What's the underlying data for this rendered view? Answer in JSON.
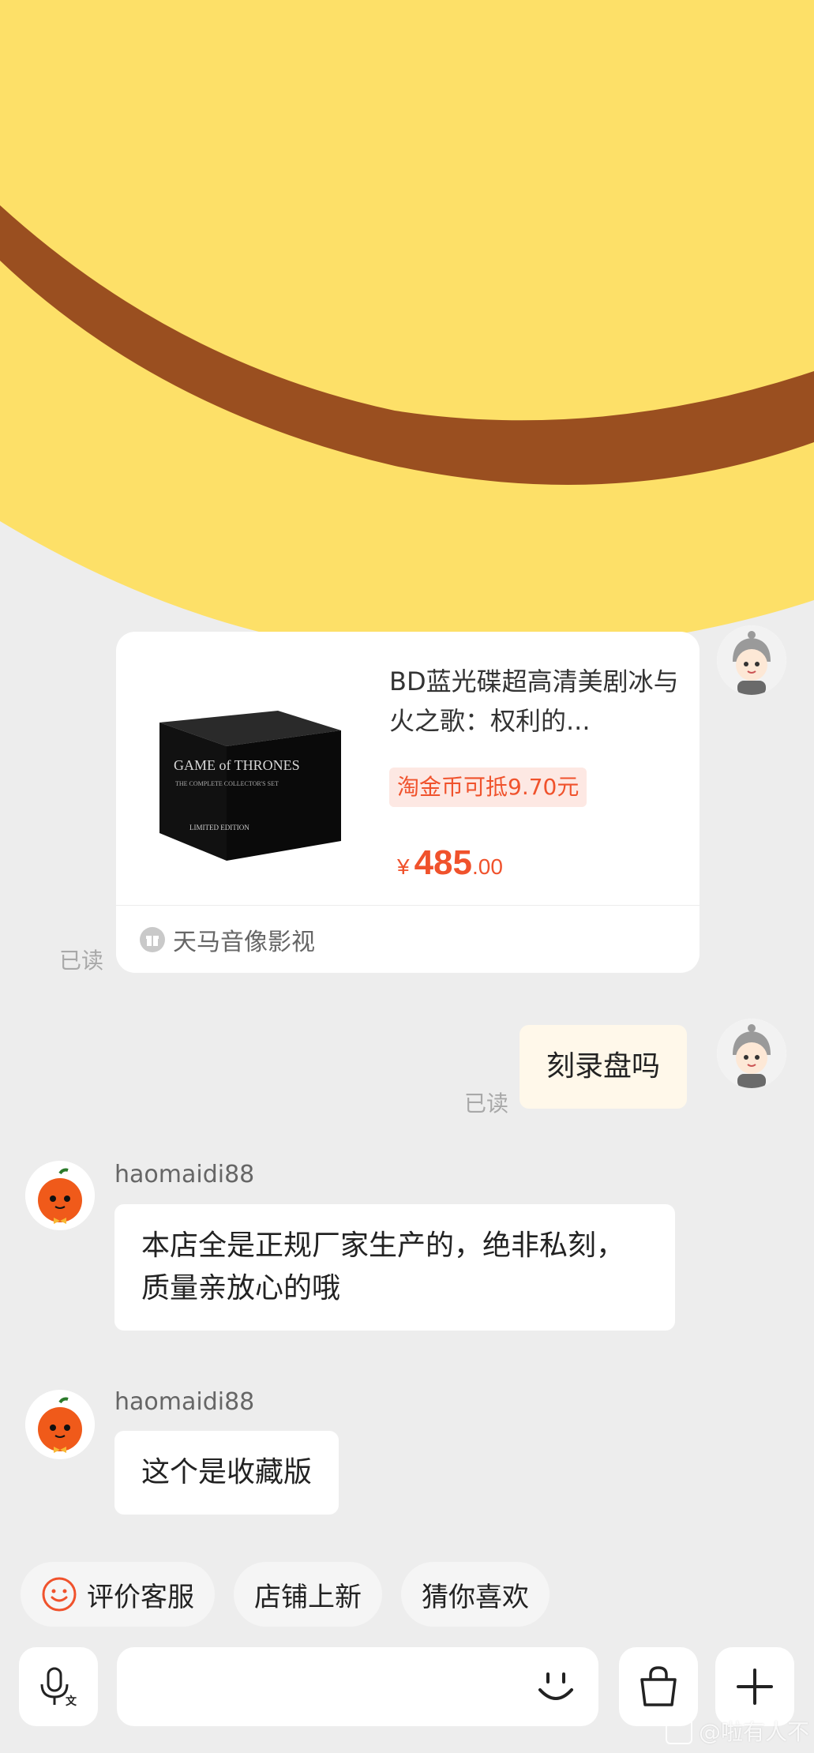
{
  "colors": {
    "background": "#ededed",
    "accent": "#f0522c",
    "banner_yellow": "#fde068",
    "banner_brown": "#9a4f20",
    "self_bubble": "#fff8ea",
    "shop_bubble": "#ffffff"
  },
  "product_card": {
    "title": "BD蓝光碟超高清美剧冰与火之歌：权利的...",
    "coin_discount": "淘金币可抵9.70元",
    "price_currency": "¥",
    "price_integer": "485",
    "price_decimal": ".00",
    "shop_name": "天马音像影视",
    "shop_icon": "gift-icon",
    "read_status": "已读"
  },
  "messages": [
    {
      "from": "self",
      "text": "刻录盘吗",
      "read_status": "已读"
    },
    {
      "from": "shop",
      "sender": "haomaidi88",
      "text": "本店全是正规厂家生产的，绝非私刻，质量亲放心的哦"
    },
    {
      "from": "shop",
      "sender": "haomaidi88",
      "text": "这个是收藏版"
    }
  ],
  "quick_replies": [
    {
      "label": "评价客服",
      "icon": "smile-icon"
    },
    {
      "label": "店铺上新"
    },
    {
      "label": "猜你喜欢"
    }
  ],
  "input_bar": {
    "voice_icon": "voice-translate-icon",
    "input_placeholder": "",
    "emoji_icon": "emoji-icon",
    "bag_icon": "shopping-bag-icon",
    "plus_icon": "plus-icon"
  },
  "watermark": "@啦有人不"
}
